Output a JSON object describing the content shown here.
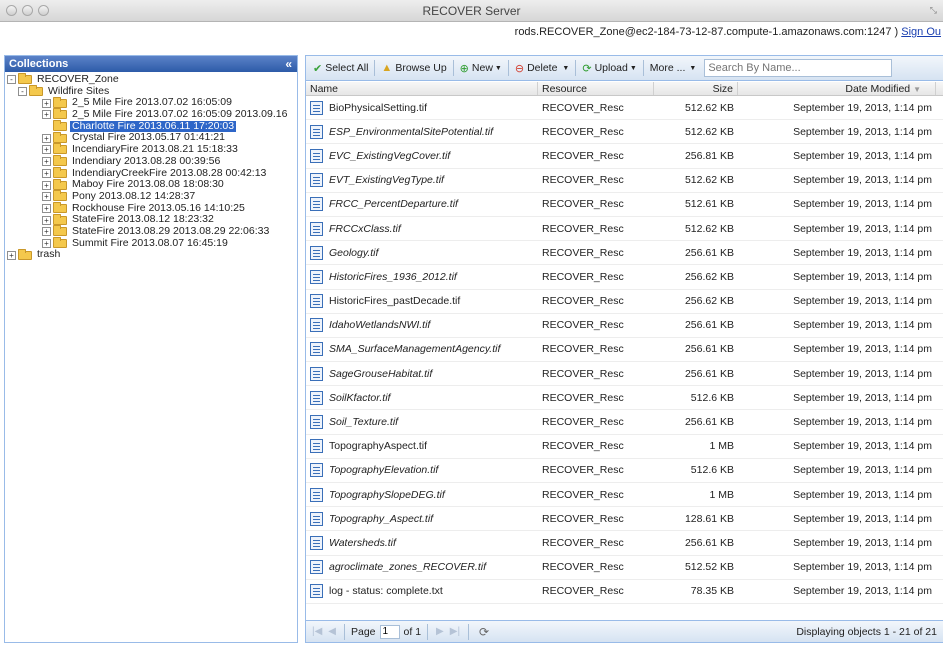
{
  "window": {
    "title": "RECOVER Server"
  },
  "userbar": {
    "info": "rods.RECOVER_Zone@ec2-184-73-12-87.compute-1.amazonaws.com:1247 )",
    "sign_out": "Sign Ou"
  },
  "collections": {
    "title": "Collections",
    "collapse_glyph": "«",
    "nodes": [
      {
        "label": "RECOVER_Zone",
        "level": 0,
        "toggle": "-"
      },
      {
        "label": "Wildfire Sites",
        "level": 1,
        "toggle": "-"
      },
      {
        "label": "2_5 Mile Fire 2013.07.02 16:05:09",
        "level": 2,
        "toggle": "+"
      },
      {
        "label": "2_5 Mile Fire 2013.07.02 16:05:09 2013.09.16",
        "level": 2,
        "toggle": "+"
      },
      {
        "label": "Charlotte Fire 2013.06.11 17:20:03",
        "level": 2,
        "toggle": "",
        "selected": true
      },
      {
        "label": "Crystal Fire 2013.05.17 01:41:21",
        "level": 2,
        "toggle": "+"
      },
      {
        "label": "IncendiaryFire 2013.08.21 15:18:33",
        "level": 2,
        "toggle": "+"
      },
      {
        "label": "Indendiary 2013.08.28 00:39:56",
        "level": 2,
        "toggle": "+"
      },
      {
        "label": "IndendiaryCreekFire 2013.08.28 00:42:13",
        "level": 2,
        "toggle": "+"
      },
      {
        "label": "Maboy Fire 2013.08.08 18:08:30",
        "level": 2,
        "toggle": "+"
      },
      {
        "label": "Pony 2013.08.12 14:28:37",
        "level": 2,
        "toggle": "+"
      },
      {
        "label": "Rockhouse Fire 2013.05.16 14:10:25",
        "level": 2,
        "toggle": "+"
      },
      {
        "label": "StateFire 2013.08.12 18:23:32",
        "level": 2,
        "toggle": "+"
      },
      {
        "label": "StateFire 2013.08.29 2013.08.29 22:06:33",
        "level": 2,
        "toggle": "+"
      },
      {
        "label": "Summit Fire 2013.08.07 16:45:19",
        "level": 2,
        "toggle": "+"
      },
      {
        "label": "trash",
        "level": 0,
        "toggle": "+"
      }
    ]
  },
  "toolbar": {
    "select_all": "Select All",
    "browse_up": "Browse Up",
    "new": "New",
    "delete": "Delete",
    "upload": "Upload",
    "more": "More ...",
    "search_placeholder": "Search By Name..."
  },
  "grid": {
    "headers": {
      "name": "Name",
      "resource": "Resource",
      "size": "Size",
      "date": "Date Modified"
    },
    "rows": [
      {
        "name": "BioPhysicalSetting.tif",
        "resource": "RECOVER_Resc",
        "size": "512.62 KB",
        "date": "September 19, 2013, 1:14 pm",
        "upright": true
      },
      {
        "name": "ESP_EnvironmentalSitePotential.tif",
        "resource": "RECOVER_Resc",
        "size": "512.62 KB",
        "date": "September 19, 2013, 1:14 pm"
      },
      {
        "name": "EVC_ExistingVegCover.tif",
        "resource": "RECOVER_Resc",
        "size": "256.81 KB",
        "date": "September 19, 2013, 1:14 pm"
      },
      {
        "name": "EVT_ExistingVegType.tif",
        "resource": "RECOVER_Resc",
        "size": "512.62 KB",
        "date": "September 19, 2013, 1:14 pm"
      },
      {
        "name": "FRCC_PercentDeparture.tif",
        "resource": "RECOVER_Resc",
        "size": "512.61 KB",
        "date": "September 19, 2013, 1:14 pm"
      },
      {
        "name": "FRCCxClass.tif",
        "resource": "RECOVER_Resc",
        "size": "512.62 KB",
        "date": "September 19, 2013, 1:14 pm"
      },
      {
        "name": "Geology.tif",
        "resource": "RECOVER_Resc",
        "size": "256.61 KB",
        "date": "September 19, 2013, 1:14 pm"
      },
      {
        "name": "HistoricFires_1936_2012.tif",
        "resource": "RECOVER_Resc",
        "size": "256.62 KB",
        "date": "September 19, 2013, 1:14 pm"
      },
      {
        "name": "HistoricFires_pastDecade.tif",
        "resource": "RECOVER_Resc",
        "size": "256.62 KB",
        "date": "September 19, 2013, 1:14 pm",
        "upright": true
      },
      {
        "name": "IdahoWetlandsNWI.tif",
        "resource": "RECOVER_Resc",
        "size": "256.61 KB",
        "date": "September 19, 2013, 1:14 pm"
      },
      {
        "name": "SMA_SurfaceManagementAgency.tif",
        "resource": "RECOVER_Resc",
        "size": "256.61 KB",
        "date": "September 19, 2013, 1:14 pm"
      },
      {
        "name": "SageGrouseHabitat.tif",
        "resource": "RECOVER_Resc",
        "size": "256.61 KB",
        "date": "September 19, 2013, 1:14 pm"
      },
      {
        "name": "SoilKfactor.tif",
        "resource": "RECOVER_Resc",
        "size": "512.6 KB",
        "date": "September 19, 2013, 1:14 pm"
      },
      {
        "name": "Soil_Texture.tif",
        "resource": "RECOVER_Resc",
        "size": "256.61 KB",
        "date": "September 19, 2013, 1:14 pm"
      },
      {
        "name": "TopographyAspect.tif",
        "resource": "RECOVER_Resc",
        "size": "1 MB",
        "date": "September 19, 2013, 1:14 pm",
        "upright": true
      },
      {
        "name": "TopographyElevation.tif",
        "resource": "RECOVER_Resc",
        "size": "512.6 KB",
        "date": "September 19, 2013, 1:14 pm"
      },
      {
        "name": "TopographySlopeDEG.tif",
        "resource": "RECOVER_Resc",
        "size": "1 MB",
        "date": "September 19, 2013, 1:14 pm"
      },
      {
        "name": "Topography_Aspect.tif",
        "resource": "RECOVER_Resc",
        "size": "128.61 KB",
        "date": "September 19, 2013, 1:14 pm"
      },
      {
        "name": "Watersheds.tif",
        "resource": "RECOVER_Resc",
        "size": "256.61 KB",
        "date": "September 19, 2013, 1:14 pm"
      },
      {
        "name": "agroclimate_zones_RECOVER.tif",
        "resource": "RECOVER_Resc",
        "size": "512.52 KB",
        "date": "September 19, 2013, 1:14 pm"
      },
      {
        "name": "log - status: complete.txt",
        "resource": "RECOVER_Resc",
        "size": "78.35 KB",
        "date": "September 19, 2013, 1:14 pm",
        "upright": true
      }
    ]
  },
  "pager": {
    "page_label": "Page",
    "page_value": "1",
    "of_label": "of 1",
    "displaying": "Displaying objects 1 - 21 of 21"
  }
}
